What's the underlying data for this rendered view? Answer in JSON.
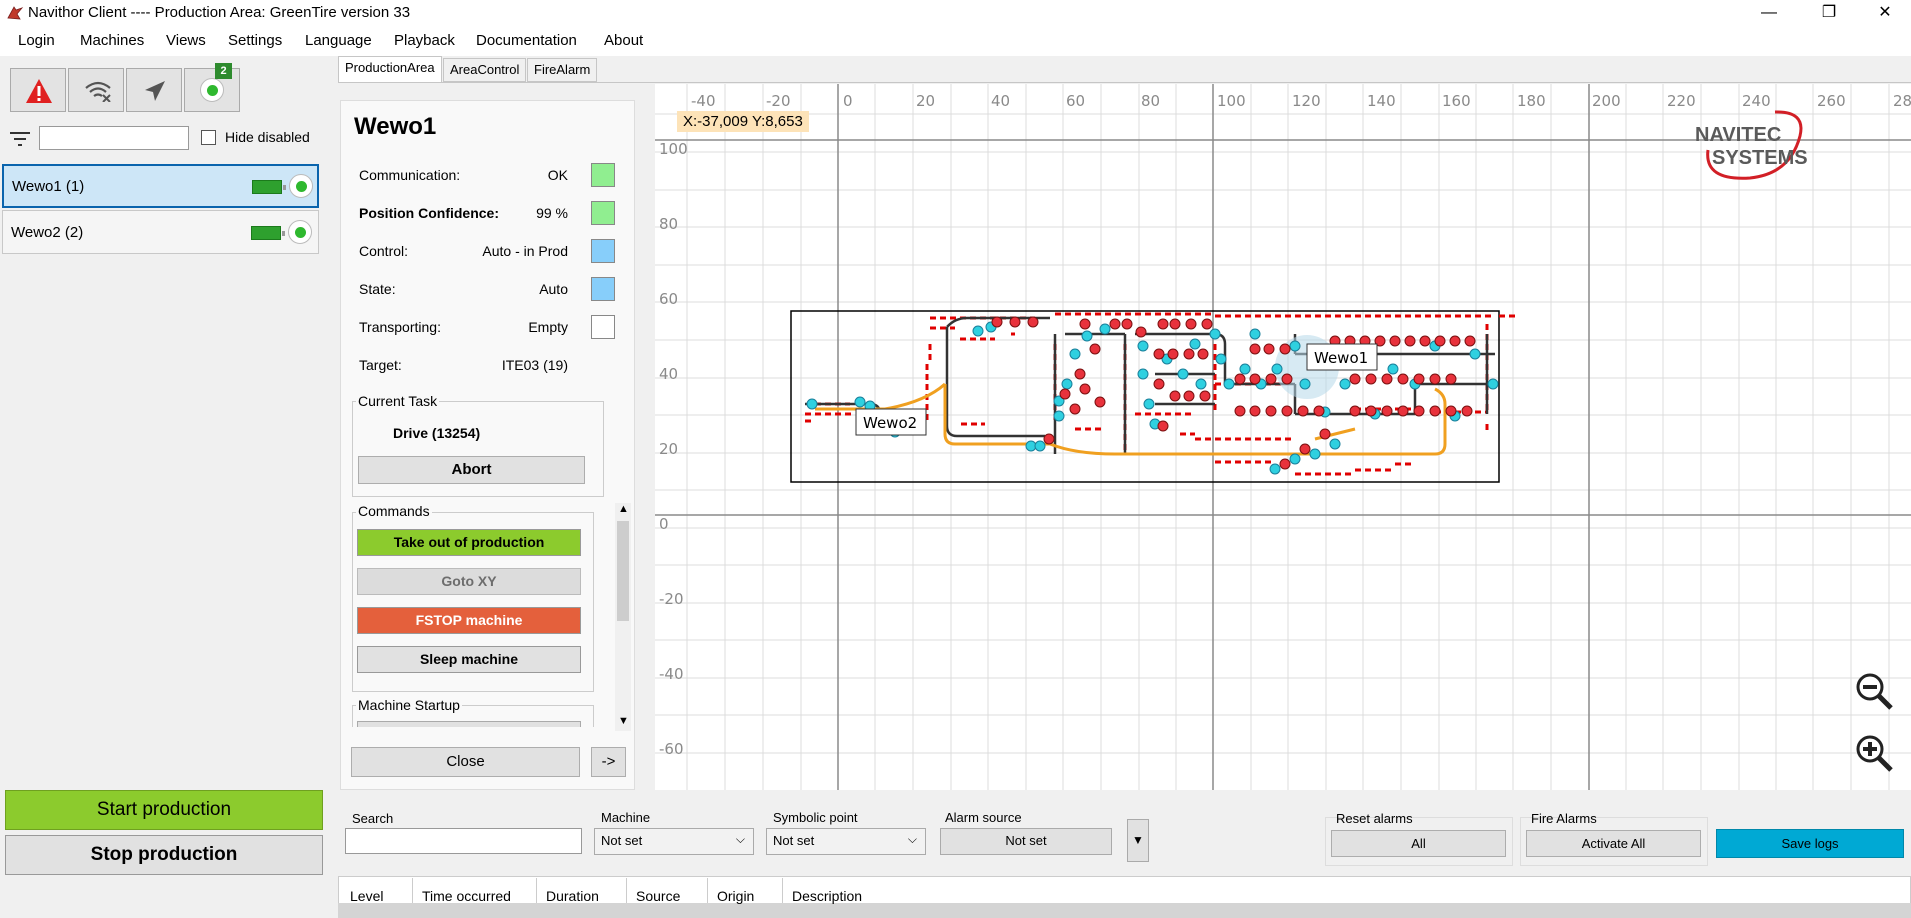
{
  "window": {
    "title": "Navithor Client ---- Production Area: GreenTire version 33",
    "minimize": "—",
    "restore": "❐",
    "close": "✕"
  },
  "menu": [
    "Login",
    "Machines",
    "Views",
    "Settings",
    "Language",
    "Playback",
    "Documentation",
    "About"
  ],
  "toolbar": {
    "icons": [
      "alert-triangle-icon",
      "wifi-off-icon",
      "airplane-icon",
      "online-status-icon"
    ],
    "online_badge": "2",
    "filter_placeholder": "",
    "hide_disabled_label": "Hide disabled",
    "hide_disabled_checked": false
  },
  "machines": [
    {
      "label": "Wewo1 (1)",
      "selected": true,
      "status": "online"
    },
    {
      "label": "Wewo2 (2)",
      "selected": false,
      "status": "online"
    }
  ],
  "production": {
    "start_label": "Start production",
    "stop_label": "Stop production"
  },
  "tabs": [
    "ProductionArea",
    "AreaControl",
    "FireAlarm"
  ],
  "detail": {
    "name": "Wewo1",
    "properties": [
      {
        "label": "Communication:",
        "value": "OK",
        "color": "#90ee90"
      },
      {
        "label": "Position Confidence:",
        "value": "99 %",
        "color": "#90ee90"
      },
      {
        "label": "Control:",
        "value": "Auto - in Prod",
        "color": "#87cefa"
      },
      {
        "label": "State:",
        "value": "Auto",
        "color": "#87cefa"
      },
      {
        "label": "Transporting:",
        "value": "Empty",
        "color": "#ffffff"
      },
      {
        "label": "Target:",
        "value": "ITE03 (19)",
        "color": ""
      }
    ],
    "current_task_title": "Current Task",
    "current_task": "Drive (13254)",
    "abort_label": "Abort",
    "commands_title": "Commands",
    "commands": [
      {
        "label": "Take out of production",
        "bg": "#8ccb2d",
        "fg": "#000000"
      },
      {
        "label": "Goto XY",
        "bg": "#dcdcdc",
        "fg": "#6d6d6d"
      },
      {
        "label": "FSTOP machine",
        "bg": "#e4603c",
        "fg": "#ffffff"
      },
      {
        "label": "Sleep machine",
        "bg": "#e1e1e1",
        "fg": "#000000"
      }
    ],
    "machine_startup_title": "Machine Startup",
    "close_label": "Close",
    "arrow_label": "->"
  },
  "map": {
    "coord_readout": "X:-37,009 Y:8,653",
    "x_ticks": [
      "-40",
      "-20",
      "0",
      "20",
      "40",
      "60",
      "80",
      "100",
      "120",
      "140",
      "160",
      "180",
      "200",
      "220",
      "240",
      "260",
      "28"
    ],
    "y_ticks": [
      "100",
      "80",
      "60",
      "40",
      "20",
      "0",
      "-20",
      "-40",
      "-60"
    ],
    "logo_line1": "NAVITEC",
    "logo_line2": "SYSTEMS",
    "vehicle_labels": [
      "Wewo1",
      "Wewo2"
    ],
    "zoom_out_icon": "zoom-out-icon",
    "zoom_in_icon": "zoom-in-icon"
  },
  "filters": {
    "search_label": "Search",
    "search_value": "",
    "machine_label": "Machine",
    "machine_value": "Not set",
    "symbolic_label": "Symbolic point",
    "symbolic_value": "Not set",
    "alarm_source_label": "Alarm source",
    "alarm_source_value": "Not set",
    "reset_alarms_label": "Reset alarms",
    "reset_all_label": "All",
    "fire_alarms_label": "Fire Alarms",
    "activate_all_label": "Activate All",
    "save_logs_label": "Save logs"
  },
  "log_columns": [
    "Level",
    "Time occurred",
    "Duration",
    "Source",
    "Origin",
    "Description"
  ]
}
